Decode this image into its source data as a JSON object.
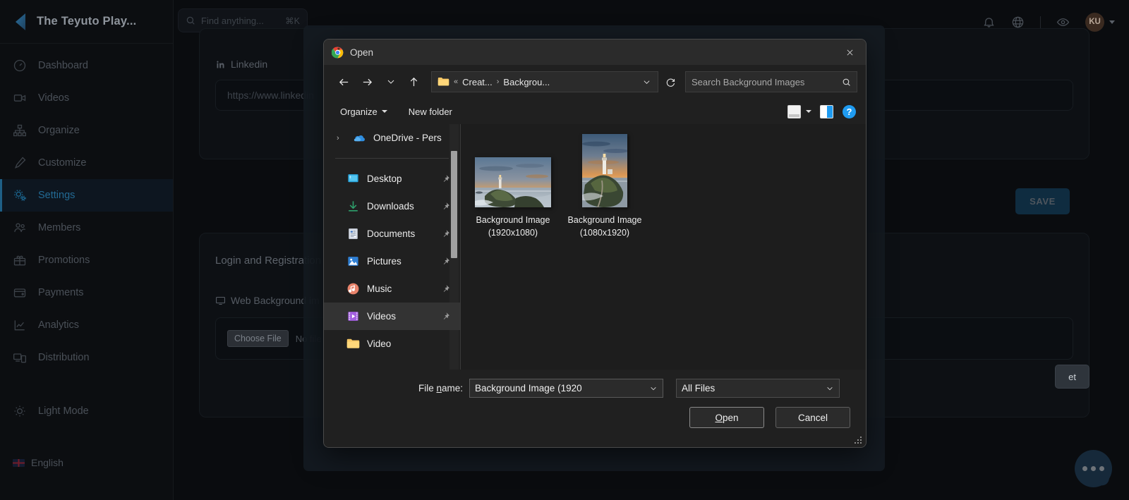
{
  "app": {
    "brand": "The Teyuto Play...",
    "search": {
      "placeholder": "Find anything...",
      "shortcut": "⌘K",
      "icon": "search-icon"
    },
    "topbar_icons": [
      "bell-icon",
      "globe-icon",
      "eye-icon"
    ],
    "avatar_initials": "KU",
    "sidebar": [
      {
        "label": "Dashboard",
        "icon": "gauge-icon",
        "active": false
      },
      {
        "label": "Videos",
        "icon": "video-camera-icon",
        "active": false
      },
      {
        "label": "Organize",
        "icon": "sitemap-icon",
        "active": false
      },
      {
        "label": "Customize",
        "icon": "brush-icon",
        "active": false
      },
      {
        "label": "Settings",
        "icon": "gears-icon",
        "active": true
      },
      {
        "label": "Members",
        "icon": "users-icon",
        "active": false
      },
      {
        "label": "Promotions",
        "icon": "gift-icon",
        "active": false
      },
      {
        "label": "Payments",
        "icon": "wallet-icon",
        "active": false
      },
      {
        "label": "Analytics",
        "icon": "chart-line-icon",
        "active": false
      },
      {
        "label": "Distribution",
        "icon": "devices-icon",
        "active": false
      }
    ],
    "light_mode": {
      "label": "Light Mode",
      "icon": "sun-icon"
    },
    "language": {
      "label": "English",
      "icon": "uk-flag-icon"
    },
    "content": {
      "linkedin_label": "Linkedin",
      "linkedin_icon": "linkedin-icon",
      "linkedin_value": "https://www.linkedin",
      "section_title": "Login and Registration",
      "background_label": "Web Background im",
      "background_icon": "monitor-icon",
      "choose_file_button": "Choose File",
      "choose_file_status": "No file",
      "save_button": "SAVE",
      "reset_button": "et",
      "chat_widget": "chat-bubble-icon"
    },
    "colors": {
      "accent": "#1e5f86",
      "save_bg": "#0f2c40",
      "sidebar_bg": "#0c0e11"
    }
  },
  "dialog": {
    "title": "Open",
    "title_icon": "chrome-logo-icon",
    "close_icon": "close-icon",
    "nav": {
      "back_icon": "arrow-left-icon",
      "forward_icon": "arrow-right-icon",
      "recent_icon": "chevron-down-icon",
      "up_icon": "arrow-up-icon",
      "refresh_icon": "refresh-icon",
      "dropdown_icon": "chevron-down-icon"
    },
    "breadcrumb": {
      "folder_icon": "folder-icon",
      "overflow": "«",
      "parts": [
        "Creat...",
        "Backgrou..."
      ],
      "separator": "›"
    },
    "search": {
      "placeholder": "Search Background Images",
      "icon": "search-icon"
    },
    "toolbar": {
      "organize": "Organize",
      "new_folder": "New folder",
      "view_icon": "view-mode-icon",
      "view_caret_icon": "chevron-down-icon",
      "preview_pane_icon": "preview-pane-icon",
      "help_icon": "help-icon",
      "help_glyph": "?"
    },
    "tree": [
      {
        "label": "OneDrive - Pers",
        "icon": "onedrive-icon",
        "expander": "›",
        "pinned": false,
        "selected": false
      },
      {
        "label": "Desktop",
        "icon": "desktop-icon",
        "expander": "",
        "pinned": true,
        "selected": false
      },
      {
        "label": "Downloads",
        "icon": "downloads-icon",
        "expander": "",
        "pinned": true,
        "selected": false
      },
      {
        "label": "Documents",
        "icon": "documents-icon",
        "expander": "",
        "pinned": true,
        "selected": false
      },
      {
        "label": "Pictures",
        "icon": "pictures-icon",
        "expander": "",
        "pinned": true,
        "selected": false
      },
      {
        "label": "Music",
        "icon": "music-icon",
        "expander": "",
        "pinned": true,
        "selected": false
      },
      {
        "label": "Videos",
        "icon": "videos-icon",
        "expander": "",
        "pinned": true,
        "selected": true
      },
      {
        "label": "Video",
        "icon": "folder-icon",
        "expander": "",
        "pinned": false,
        "selected": false
      }
    ],
    "files": [
      {
        "name": "Background Image (1920x1080)",
        "orientation": "landscape",
        "thumb": "lighthouse-sunset-thumb"
      },
      {
        "name": "Background Image (1080x1920)",
        "orientation": "portrait",
        "thumb": "lighthouse-sunset-thumb"
      }
    ],
    "footer": {
      "file_name_label_pre": "File ",
      "file_name_label_underlined": "n",
      "file_name_label_post": "ame:",
      "file_name_value": "Background Image (1920",
      "file_type_value": "All Files",
      "open_underlined": "O",
      "open_rest": "pen",
      "cancel_button": "Cancel",
      "chevron_icon": "chevron-down-icon",
      "resize_grip_icon": "resize-grip-icon"
    }
  }
}
